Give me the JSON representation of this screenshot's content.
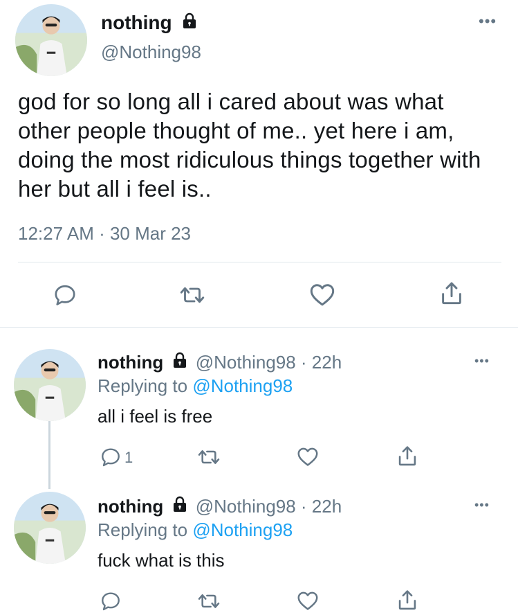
{
  "main_tweet": {
    "display_name": "nothing",
    "handle": "@Nothing98",
    "text": "god for so long all i cared about was what other people thought of me.. yet here i am, doing the most ridiculous things together with her but all i feel is..",
    "timestamp": "12:27 AM · 30 Mar 23",
    "icons": [
      "reply-icon",
      "retweet-icon",
      "like-icon",
      "share-icon",
      "more-icon",
      "lock-icon"
    ]
  },
  "replies": [
    {
      "display_name": "nothing",
      "handle_time": "@Nothing98 · 22h",
      "replying_prefix": "Replying to",
      "replying_to": "@Nothing98",
      "text": "all i feel is free",
      "reply_count": "1"
    },
    {
      "display_name": "nothing",
      "handle_time": "@Nothing98 · 22h",
      "replying_prefix": "Replying to",
      "replying_to": "@Nothing98",
      "text": "fuck what is this",
      "reply_count": ""
    }
  ],
  "colors": {
    "text": "#14171a",
    "secondary": "#657786",
    "link": "#1da1f2",
    "divider": "#e1e8ed"
  }
}
